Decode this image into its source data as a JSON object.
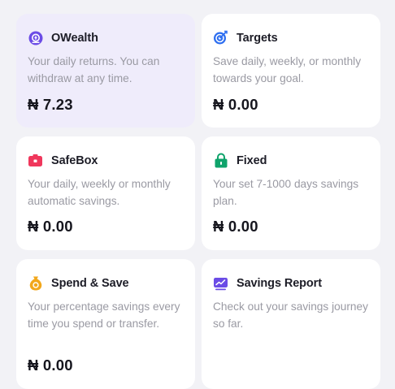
{
  "cards": [
    {
      "title": "OWealth",
      "desc": "Your daily returns. You can withdraw at any time.",
      "amount": "₦ 7.23",
      "icon": "owealth-icon",
      "color": "#6b4ce6"
    },
    {
      "title": "Targets",
      "desc": "Save daily, weekly, or monthly towards your goal.",
      "amount": "₦ 0.00",
      "icon": "target-icon",
      "color": "#2d6ef0"
    },
    {
      "title": "SafeBox",
      "desc": "Your daily, weekly or monthly automatic savings.",
      "amount": "₦ 0.00",
      "icon": "safebox-icon",
      "color": "#f0375c"
    },
    {
      "title": "Fixed",
      "desc": "Your set 7-1000 days savings plan.",
      "amount": "₦ 0.00",
      "icon": "lock-icon",
      "color": "#0fa36b"
    },
    {
      "title": "Spend & Save",
      "desc": "Your percentage savings every time you spend or transfer.",
      "amount": "₦ 0.00",
      "icon": "money-bag-icon",
      "color": "#f2a71b"
    },
    {
      "title": "Savings Report",
      "desc": "Check out your savings journey so far.",
      "icon": "report-icon",
      "color": "#6b4ce6"
    }
  ]
}
